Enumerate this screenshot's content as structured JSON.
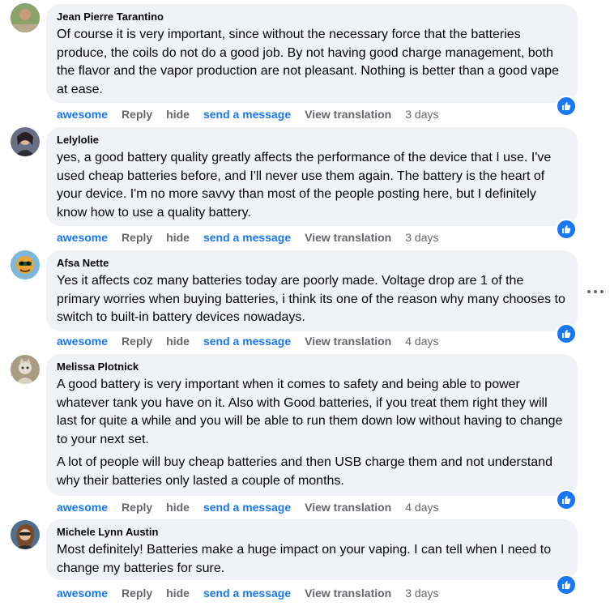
{
  "actions": {
    "react": "awesome",
    "reply": "Reply",
    "hide": "hide",
    "message": "send a message",
    "translate": "View translation"
  },
  "comments": [
    {
      "author": "Jean Pierre Tarantino",
      "paragraphs": [
        "Of course it is very important, since without the necessary force that the batteries produce, the coils do not do a good job. By not having good charge management, both the flavor and the vapor production are not pleasant. Nothing is better than a good vape at ease."
      ],
      "time": "3 days"
    },
    {
      "author": "Lelylolie",
      "paragraphs": [
        "yes, a good battery quality greatly affects the performance of the device that I use. I've used cheap batteries before, and I'll never use them again. The battery is the heart of your device. I'm no more savvy than most of the people posting here, but I definitely know how to use a quality battery."
      ],
      "time": "3 days"
    },
    {
      "author": "Afsa Nette",
      "paragraphs": [
        "Yes it affects coz many batteries today are poorly made. Voltage drop are 1 of the primary worries when buying batteries, i think its one of the reason why many chooses to switch to built-in battery devices nowadays."
      ],
      "time": "4 days"
    },
    {
      "author": "Melissa Plotnick",
      "paragraphs": [
        "A good battery is very important when it comes to safety and being able to power whatever tank you have on it. Also with Good batteries, if you treat them right they will last for quite a while and you will be able to run them down low without having to change to your next set.",
        "A lot of people will buy cheap batteries and then USB charge them and not understand why their batteries only lasted a couple of months."
      ],
      "time": "4 days"
    },
    {
      "author": "Michele Lynn Austin",
      "paragraphs": [
        "Most definitely! Batteries make a huge impact on your vaping. I can tell when I need to change my batteries for sure."
      ],
      "time": "3 days"
    }
  ],
  "colors": {
    "accent": "#1877f2",
    "bubble": "#f0f2f5",
    "muted": "#65676b"
  },
  "icons": {
    "reaction": "like-icon",
    "menu": "more-options-icon"
  }
}
